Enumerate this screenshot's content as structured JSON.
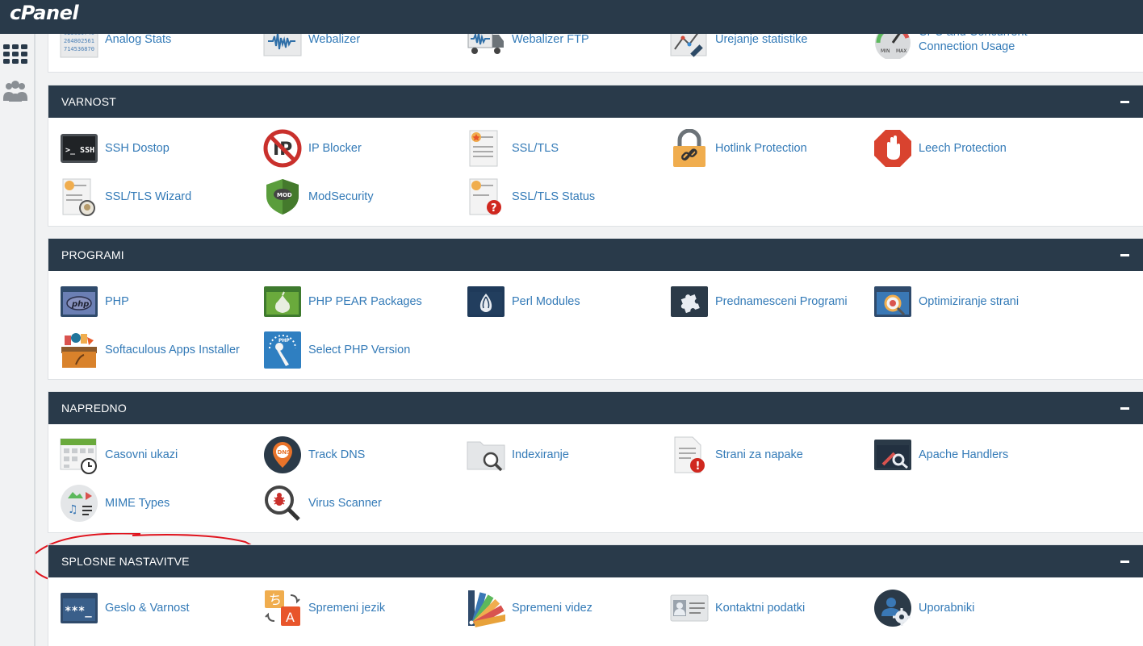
{
  "app": {
    "logo_text": "cPanel"
  },
  "sidebar": {
    "items": [
      {
        "icon": "grid-icon"
      },
      {
        "icon": "users-icon"
      }
    ]
  },
  "sections": {
    "stats": {
      "items": [
        {
          "label": "Analog Stats",
          "icon": "analog-stats-icon"
        },
        {
          "label": "Webalizer",
          "icon": "webalizer-icon"
        },
        {
          "label": "Webalizer FTP",
          "icon": "webalizer-ftp-icon"
        },
        {
          "label": "Urejanje statistike",
          "icon": "stats-config-icon"
        },
        {
          "label": "CPU and Concurrent Connection Usage",
          "icon": "cpu-gauge-icon"
        }
      ]
    },
    "security": {
      "title": "VARNOST",
      "items": [
        {
          "label": "SSH Dostop",
          "icon": "terminal-icon"
        },
        {
          "label": "IP Blocker",
          "icon": "ip-blocker-icon"
        },
        {
          "label": "SSL/TLS",
          "icon": "certificate-icon"
        },
        {
          "label": "Hotlink Protection",
          "icon": "padlock-icon"
        },
        {
          "label": "Leech Protection",
          "icon": "stop-hand-icon"
        },
        {
          "label": "SSL/TLS Wizard",
          "icon": "ssl-wizard-icon"
        },
        {
          "label": "ModSecurity",
          "icon": "shield-mod-icon"
        },
        {
          "label": "SSL/TLS Status",
          "icon": "ssl-status-icon"
        }
      ]
    },
    "software": {
      "title": "PROGRAMI",
      "items": [
        {
          "label": "PHP",
          "icon": "php-icon"
        },
        {
          "label": "PHP PEAR Packages",
          "icon": "pear-icon"
        },
        {
          "label": "Perl Modules",
          "icon": "perl-onion-icon"
        },
        {
          "label": "Prednamesceni Programi",
          "icon": "puzzle-icon"
        },
        {
          "label": "Optimiziranje strani",
          "icon": "optimize-icon"
        },
        {
          "label": "Softaculous Apps Installer",
          "icon": "softaculous-box-icon"
        },
        {
          "label": "Select PHP Version",
          "icon": "php-version-icon"
        }
      ]
    },
    "advanced": {
      "title": "NAPREDNO",
      "items": [
        {
          "label": "Casovni ukazi",
          "icon": "calendar-clock-icon"
        },
        {
          "label": "Track DNS",
          "icon": "dns-pin-icon"
        },
        {
          "label": "Indexiranje",
          "icon": "folder-search-icon"
        },
        {
          "label": "Strani za napake",
          "icon": "error-page-icon"
        },
        {
          "label": "Apache Handlers",
          "icon": "apache-handlers-icon"
        },
        {
          "label": "MIME Types",
          "icon": "mime-types-icon"
        },
        {
          "label": "Virus Scanner",
          "icon": "virus-scanner-icon"
        }
      ]
    },
    "preferences": {
      "title": "SPLOSNE NASTAVITVE",
      "items": [
        {
          "label": "Geslo & Varnost",
          "icon": "password-icon"
        },
        {
          "label": "Spremeni jezik",
          "icon": "language-icon"
        },
        {
          "label": "Spremeni videz",
          "icon": "color-palette-icon"
        },
        {
          "label": "Kontaktni podatki",
          "icon": "contact-card-icon"
        },
        {
          "label": "Uporabniki",
          "icon": "user-manager-icon"
        }
      ]
    }
  },
  "colors": {
    "header": "#293a4a",
    "link": "#337ab7",
    "annotation": "#e0141e"
  }
}
